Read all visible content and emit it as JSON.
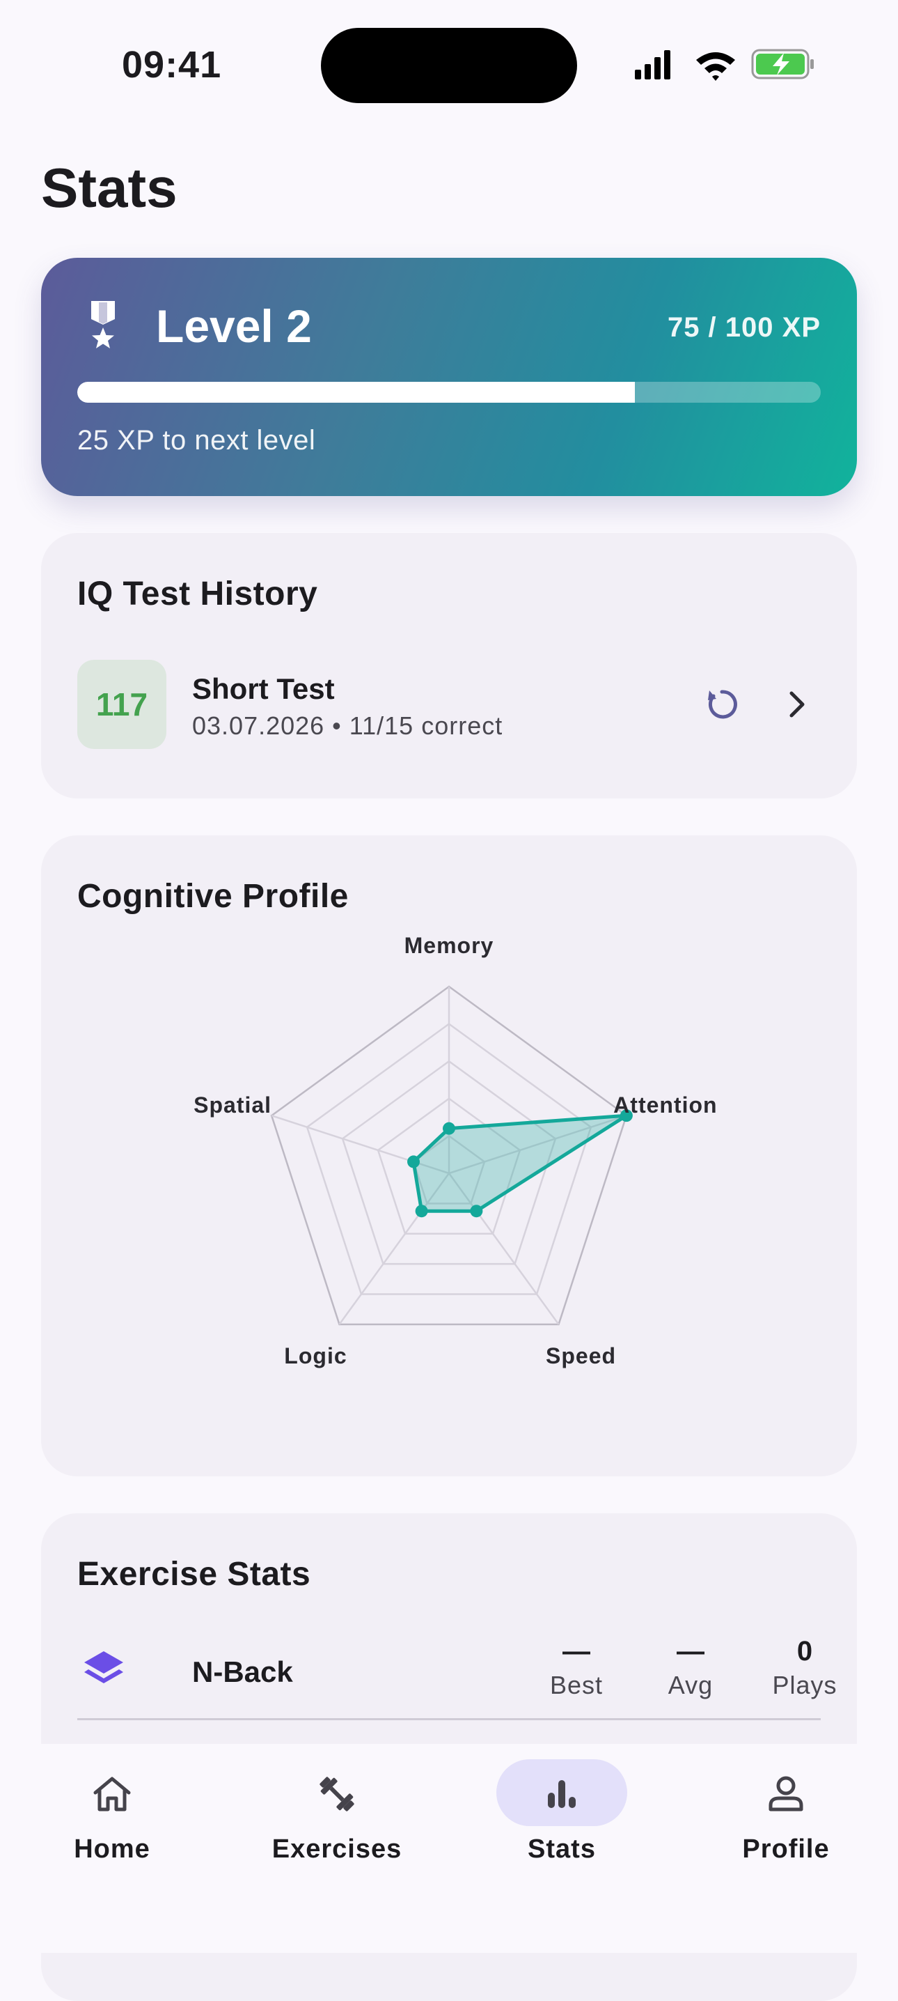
{
  "status_bar": {
    "time": "09:41"
  },
  "page": {
    "title": "Stats"
  },
  "level_card": {
    "title": "Level 2",
    "xp_text": "75 / 100 XP",
    "xp_progress": 0.75,
    "next_text": "25 XP to next level",
    "gradient_start": "#5C5B9A",
    "gradient_end": "#11B39C"
  },
  "history": {
    "title": "IQ Test History",
    "items": [
      {
        "score": "117",
        "name": "Short Test",
        "meta": "03.07.2026 • 11/15 correct"
      }
    ]
  },
  "profile": {
    "title": "Cognitive Profile"
  },
  "chart_data": {
    "type": "radar",
    "categories": [
      "Memory",
      "Attention",
      "Speed",
      "Logic",
      "Spatial"
    ],
    "values": [
      0.24,
      1.0,
      0.25,
      0.25,
      0.2
    ],
    "range": [
      0,
      1
    ],
    "rings": 4,
    "color": "#14A89A"
  },
  "exercise_stats": {
    "title": "Exercise Stats",
    "columns": [
      "Best",
      "Avg",
      "Plays"
    ],
    "rows": [
      {
        "icon": "layers-icon",
        "name": "N-Back",
        "best": "—",
        "avg": "—",
        "plays": "0"
      }
    ]
  },
  "nav": {
    "items": [
      {
        "label": "Home",
        "icon": "home-icon"
      },
      {
        "label": "Exercises",
        "icon": "dumbbell-icon"
      },
      {
        "label": "Stats",
        "icon": "bar-chart-icon",
        "active": true
      },
      {
        "label": "Profile",
        "icon": "person-icon"
      }
    ]
  },
  "colors": {
    "accent": "#14A89A",
    "score_green": "#43A24E",
    "nav_active": "#E3E0FA",
    "icon_purple": "#6B4EE6"
  }
}
